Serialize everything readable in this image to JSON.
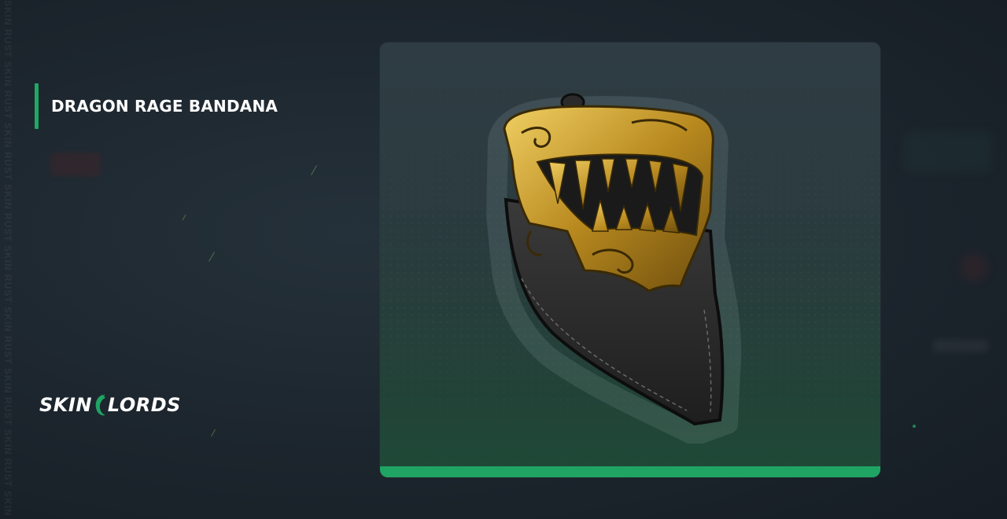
{
  "background": {
    "watermark": "SKIN RUST SKIN RUST SKIN RUST SKIN RUST SKIN RUST SKIN RUST SKIN RUST SKIN RUST SKIN RUST SKIN RUST"
  },
  "item": {
    "name": "DRAGON RAGE BANDANA",
    "image_icon": "dragon-bandana-icon"
  },
  "brand": {
    "left": "SKIN",
    "right": "LORDS",
    "mark_icon": "dragon-mark-icon"
  },
  "colors": {
    "accent": "#1fa463",
    "background": "#1c252d",
    "gold": "#c9a030",
    "cloth": "#2b2b2b"
  }
}
